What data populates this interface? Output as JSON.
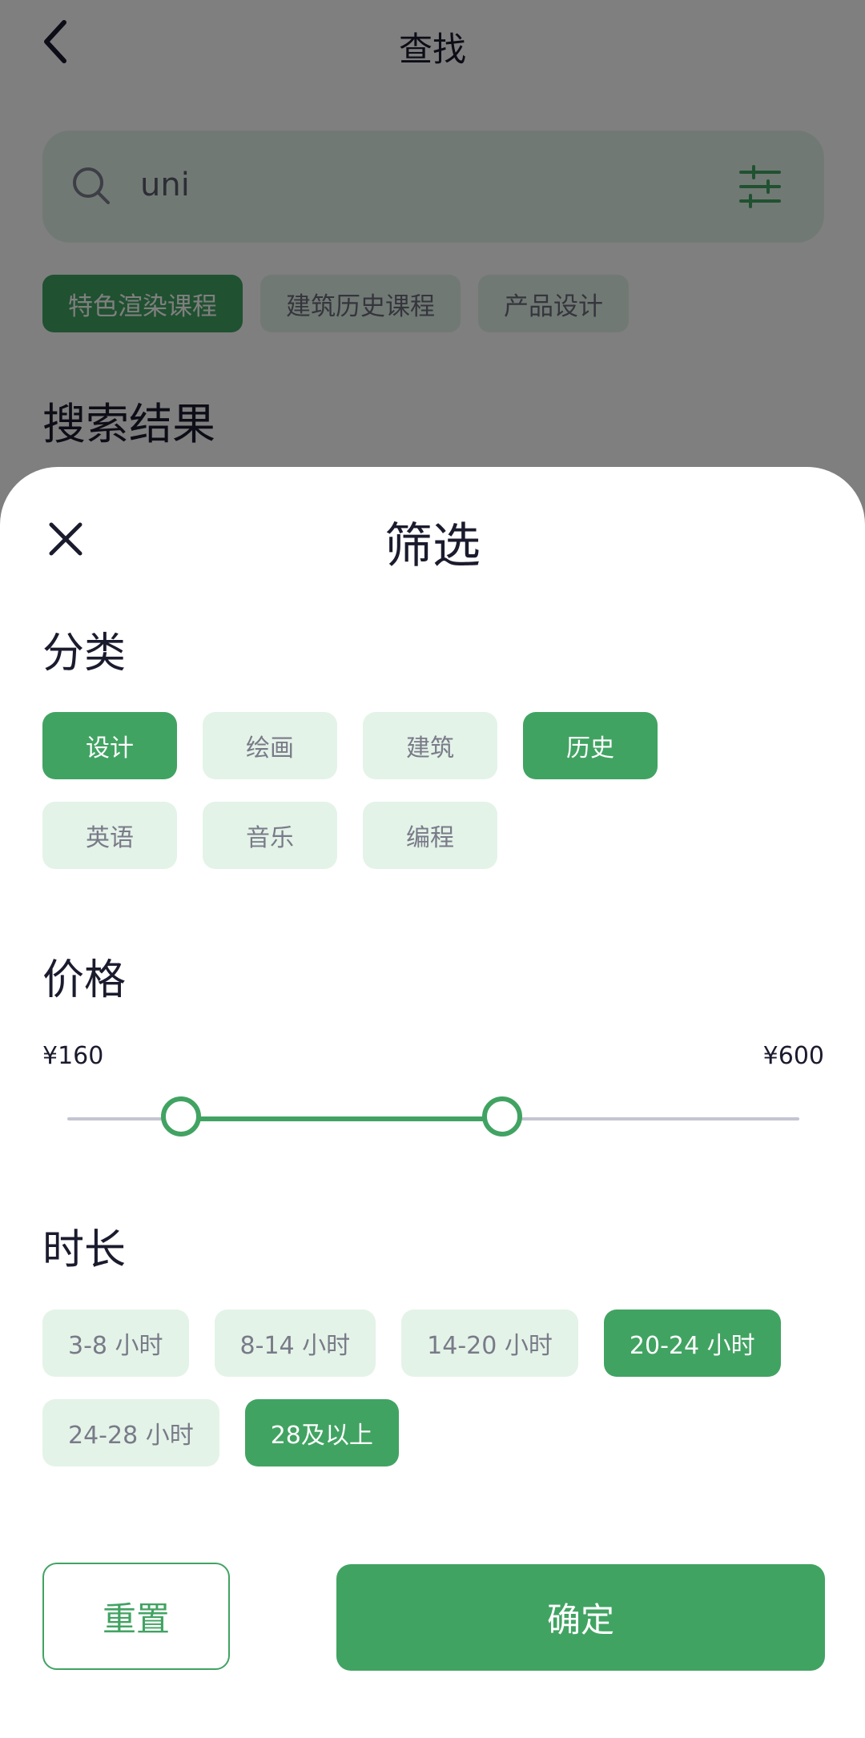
{
  "header": {
    "title": "查找"
  },
  "search": {
    "value": "uni"
  },
  "tags": [
    {
      "label": "特色渲染课程",
      "active": true
    },
    {
      "label": "建筑历史课程",
      "active": false
    },
    {
      "label": "产品设计",
      "active": false
    }
  ],
  "results_title": "搜索结果",
  "sheet": {
    "title": "筛选",
    "category": {
      "title": "分类",
      "options": [
        {
          "label": "设计",
          "selected": true
        },
        {
          "label": "绘画",
          "selected": false
        },
        {
          "label": "建筑",
          "selected": false
        },
        {
          "label": "历史",
          "selected": true
        },
        {
          "label": "英语",
          "selected": false
        },
        {
          "label": "音乐",
          "selected": false
        },
        {
          "label": "编程",
          "selected": false
        }
      ]
    },
    "price": {
      "title": "价格",
      "min_label": "¥160",
      "max_label": "¥600",
      "range_low_fraction": 0.155,
      "range_high_fraction": 0.594
    },
    "duration": {
      "title": "时长",
      "options": [
        {
          "label": "3-8 小时",
          "selected": false
        },
        {
          "label": "8-14 小时",
          "selected": false
        },
        {
          "label": "14-20 小时",
          "selected": false
        },
        {
          "label": "20-24 小时",
          "selected": true
        },
        {
          "label": "24-28 小时",
          "selected": false
        },
        {
          "label": "28及以上",
          "selected": true
        }
      ]
    },
    "reset_label": "重置",
    "confirm_label": "确定"
  },
  "colors": {
    "accent": "#41a362",
    "chip_bg": "#e3f3e8",
    "text_dark": "#1b1b2e"
  },
  "icons": [
    "back-icon",
    "search-icon",
    "filter-sliders-icon",
    "close-icon"
  ]
}
